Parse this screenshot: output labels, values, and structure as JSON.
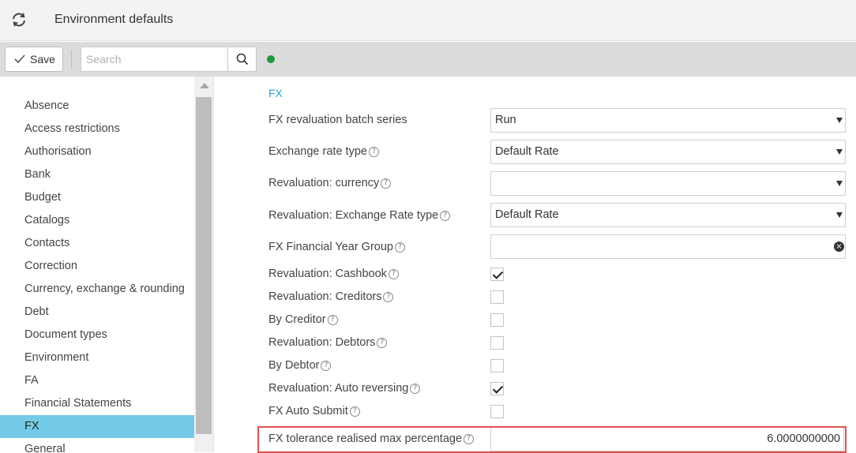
{
  "header": {
    "title": "Environment defaults",
    "refresh_icon": "refresh-icon"
  },
  "toolbar": {
    "save_label": "Save",
    "search_placeholder": "Search",
    "status_color": "#1a9a3a"
  },
  "sidebar": {
    "items": [
      {
        "label": "Absence"
      },
      {
        "label": "Access restrictions"
      },
      {
        "label": "Authorisation"
      },
      {
        "label": "Bank"
      },
      {
        "label": "Budget"
      },
      {
        "label": "Catalogs"
      },
      {
        "label": "Contacts"
      },
      {
        "label": "Correction"
      },
      {
        "label": "Currency, exchange & rounding"
      },
      {
        "label": "Debt"
      },
      {
        "label": "Document types"
      },
      {
        "label": "Environment"
      },
      {
        "label": "FA"
      },
      {
        "label": "Financial Statements"
      },
      {
        "label": "FX",
        "active": true
      },
      {
        "label": "General"
      }
    ]
  },
  "main": {
    "section_title": "FX",
    "help_glyph": "?",
    "fields": {
      "batch_series": {
        "label": "FX revaluation batch series",
        "value": "Run"
      },
      "exchange_rate_type": {
        "label": "Exchange rate type",
        "value": "Default Rate"
      },
      "reval_currency": {
        "label": "Revaluation: currency",
        "value": ""
      },
      "reval_exchange_rate_type": {
        "label": "Revaluation: Exchange Rate type",
        "value": "Default Rate"
      },
      "financial_year_group": {
        "label": "FX Financial Year Group",
        "value": ""
      },
      "reval_cashbook": {
        "label": "Revaluation: Cashbook",
        "checked": true
      },
      "reval_creditors": {
        "label": "Revaluation: Creditors",
        "checked": false
      },
      "by_creditor": {
        "label": "By Creditor",
        "checked": false
      },
      "reval_debtors": {
        "label": "Revaluation: Debtors",
        "checked": false
      },
      "by_debtor": {
        "label": "By Debtor",
        "checked": false
      },
      "reval_auto_reversing": {
        "label": "Revaluation: Auto reversing",
        "checked": true
      },
      "auto_submit": {
        "label": "FX Auto Submit",
        "checked": false
      },
      "tolerance_max_pct": {
        "label": "FX tolerance realised max percentage",
        "value": "6.0000000000"
      }
    },
    "highlight_color": "#e05050",
    "accent_color": "#2aa3d6"
  }
}
